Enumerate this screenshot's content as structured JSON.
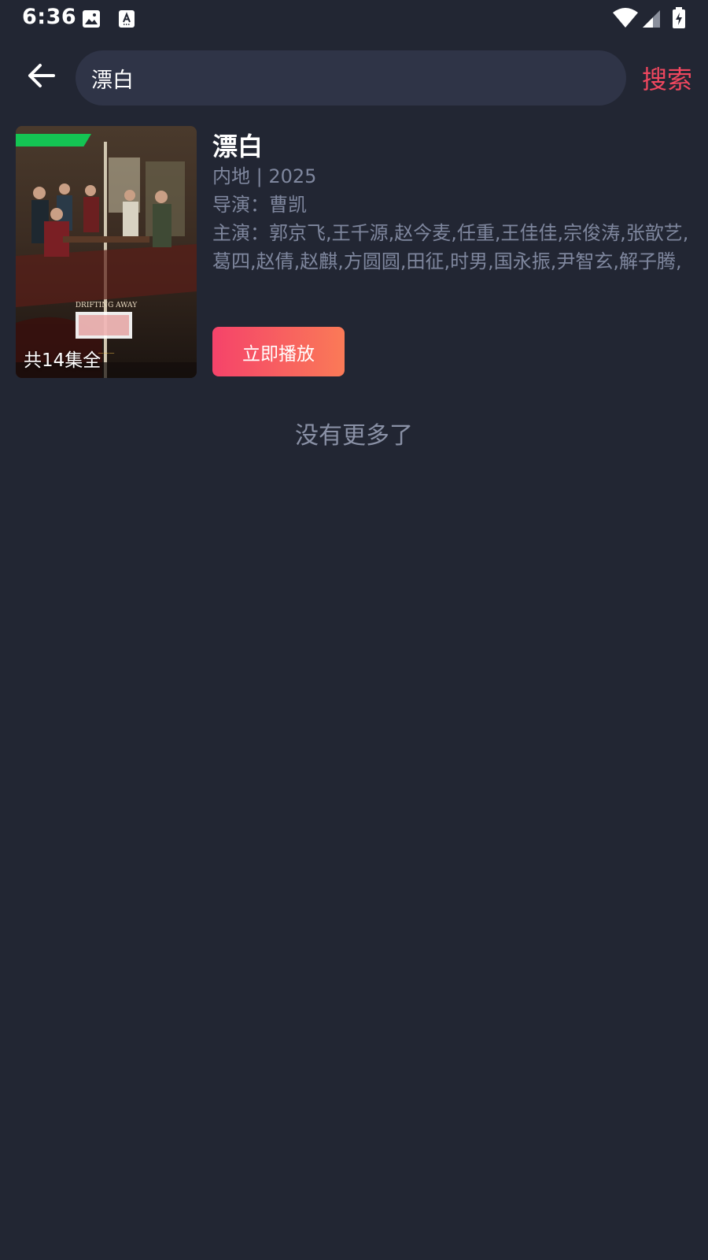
{
  "status_bar": {
    "time": "6:36",
    "icons": [
      "image-icon",
      "text-a-icon",
      "wifi-icon",
      "signal-icon",
      "battery-charging-icon"
    ]
  },
  "search": {
    "value": "漂白",
    "placeholder": "",
    "button_label": "搜索"
  },
  "result": {
    "title": "漂白",
    "region_year": "内地 | 2025",
    "director": "导演：曹凯",
    "cast": "主演：郭京飞,王千源,赵今麦,任重,王佳佳,宗俊涛,张歆艺,葛四,赵倩,赵麒,方圆圆,田征,时男,国永振,尹智玄,解子腾,孙延",
    "episodes": "共14集全",
    "play_label": "立即播放"
  },
  "footer": {
    "no_more": "没有更多了"
  },
  "colors": {
    "background": "#222633",
    "search_box": "#2f3447",
    "accent": "#f0475f",
    "muted_text": "#7f879e"
  }
}
